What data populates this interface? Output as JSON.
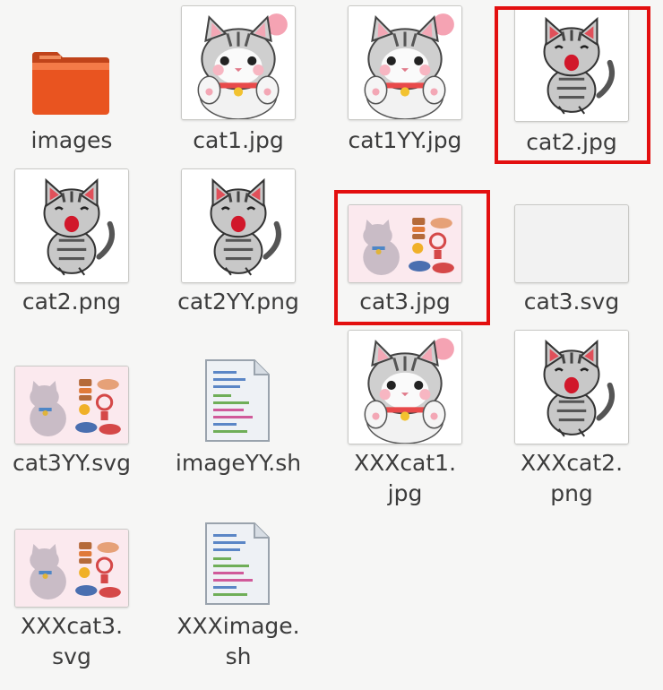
{
  "files": [
    {
      "name": "images",
      "icon": "folder-icon"
    },
    {
      "name": "cat1.jpg",
      "icon": "cat-paw-thumbnail"
    },
    {
      "name": "cat1YY.jpg",
      "icon": "cat-paw-thumbnail"
    },
    {
      "name": "cat2.jpg",
      "icon": "cat-meow-thumbnail"
    },
    {
      "name": "cat2.png",
      "icon": "cat-meow-thumbnail"
    },
    {
      "name": "cat2YY.png",
      "icon": "cat-meow-thumbnail"
    },
    {
      "name": "cat3.jpg",
      "icon": "cat-sticker-thumbnail"
    },
    {
      "name": "cat3.svg",
      "icon": "blank-thumbnail"
    },
    {
      "name": "cat3YY.svg",
      "icon": "cat-sticker-thumbnail"
    },
    {
      "name": "imageYY.sh",
      "icon": "script-file-icon"
    },
    {
      "name": "XXXcat1.\njpg",
      "icon": "cat-paw-thumbnail"
    },
    {
      "name": "XXXcat2.\npng",
      "icon": "cat-meow-thumbnail"
    },
    {
      "name": "XXXcat3.\nsvg",
      "icon": "cat-sticker-thumbnail"
    },
    {
      "name": "XXXimage.\nsh",
      "icon": "script-file-icon"
    }
  ],
  "highlight_color": "#e30f0f",
  "folder_color": "#e95420"
}
